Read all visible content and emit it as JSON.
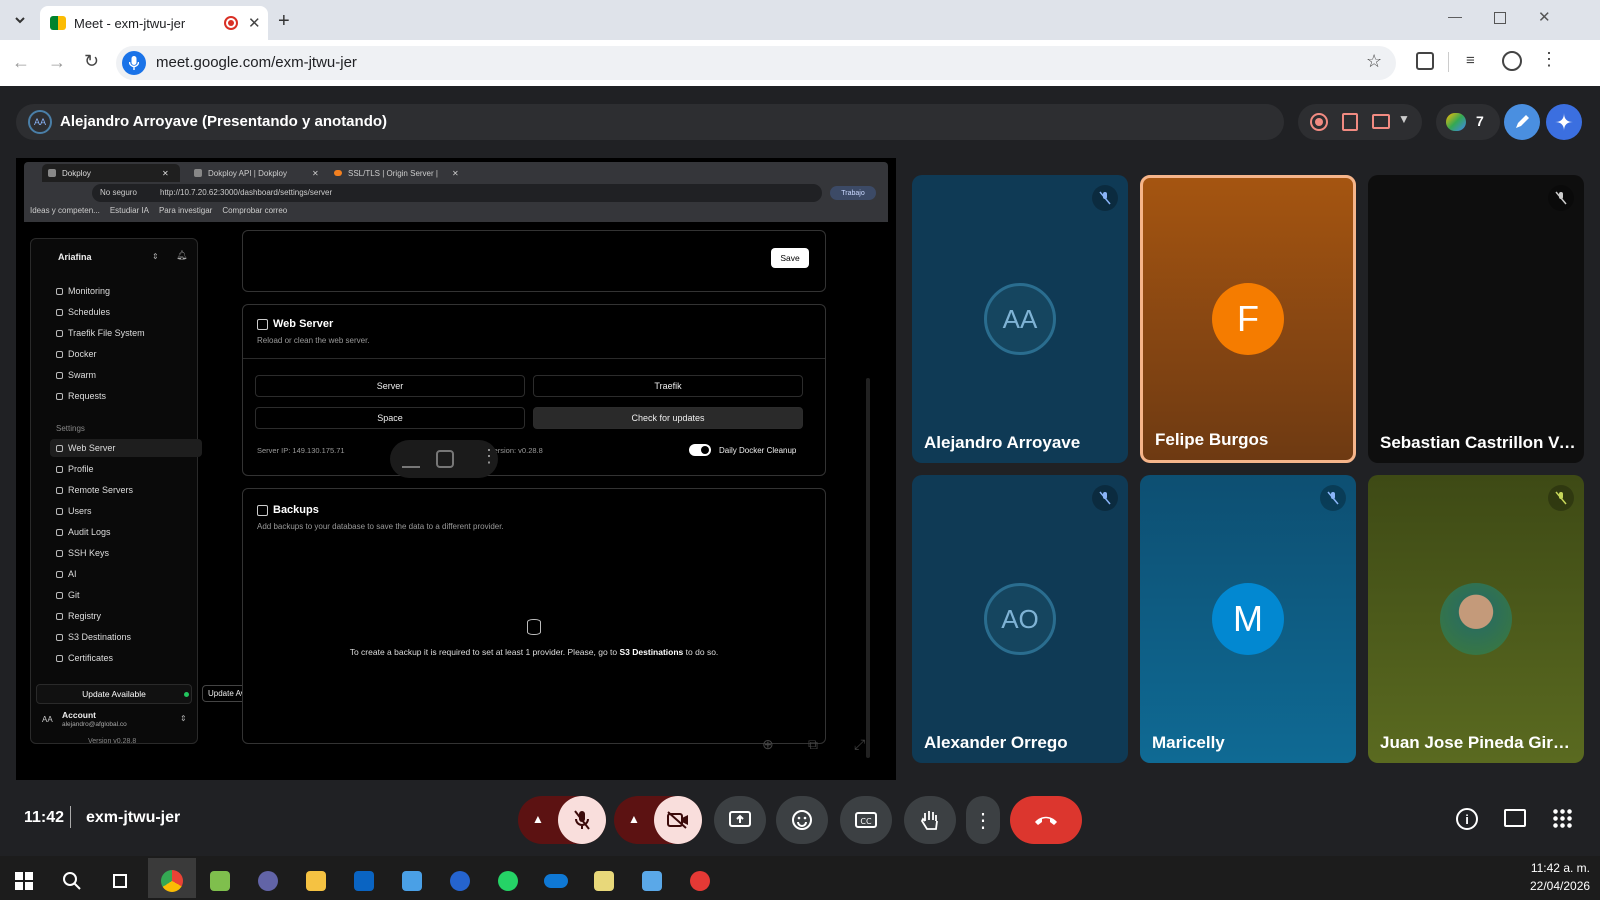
{
  "browser": {
    "tab_title": "Meet - exm-jtwu-jer",
    "url": "meet.google.com/exm-jtwu-jer"
  },
  "meet": {
    "presenter_banner": "Alejandro Arroyave (Presentando y anotando)",
    "people_count": "7",
    "clock": "11:42",
    "meeting_code": "exm-jtwu-jer",
    "participants": [
      {
        "name": "Alejandro Arroyave",
        "initials": "AA",
        "bg": "#0f3a55",
        "muted": true
      },
      {
        "name": "Felipe Burgos",
        "initials": "F",
        "bg": "#8a4a12",
        "muted": false,
        "speaking": true
      },
      {
        "name": "Sebastian Castrillon Ve...",
        "initials": "",
        "bg": "#111111",
        "muted": true
      },
      {
        "name": "Alexander Orrego",
        "initials": "AO",
        "bg": "#0f3a55",
        "muted": true
      },
      {
        "name": "Maricelly",
        "initials": "M",
        "bg": "#0e5a80",
        "muted": true
      },
      {
        "name": "Juan Jose Pineda Gira...",
        "initials": "",
        "bg": "#4a5a18",
        "muted": true
      }
    ]
  },
  "shared": {
    "tabs": [
      "Dokploy",
      "Dokploy API | Dokploy",
      "SSL/TLS | Origin Server |"
    ],
    "security": "No seguro",
    "url": "http://10.7.20.62:3000/dashboard/settings/server",
    "profile": "Trabajo",
    "bookmarks": [
      "Ideas y competen...",
      "Estudiar IA",
      "Para investigar",
      "Comprobar correo"
    ],
    "org": "Ariafina",
    "menu": [
      "Monitoring",
      "Schedules",
      "Traefik File System",
      "Docker",
      "Swarm",
      "Requests"
    ],
    "settings_label": "Settings",
    "settings_menu": [
      "Web Server",
      "Profile",
      "Remote Servers",
      "Users",
      "Audit Logs",
      "SSH Keys",
      "AI",
      "Git",
      "Registry",
      "S3 Destinations",
      "Certificates"
    ],
    "update_btn": "Update Available",
    "update_tooltip": "Update Available",
    "account": "Account",
    "account_initials": "AA",
    "email": "alejandro@afglobal.co",
    "version": "Version v0.28.8",
    "save": "Save",
    "web_server_title": "Web Server",
    "web_server_desc": "Reload or clean the web server.",
    "btn_server": "Server",
    "btn_traefik": "Traefik",
    "btn_space": "Space",
    "btn_updates": "Check for updates",
    "server_ip": "Server IP: 149.130.175.71",
    "server_version": "Version: v0.28.8",
    "cleanup": "Daily Docker Cleanup",
    "backups_title": "Backups",
    "backups_desc": "Add backups to your database to save the data to a different provider.",
    "backups_msg_pre": "To create a backup it is required to set at least 1 provider. Please, go to",
    "backups_link": "S3 Destinations",
    "backups_msg_post": "to do so."
  },
  "taskbar": {
    "time": "11:42 a. m.",
    "date": "22/04/2026"
  }
}
